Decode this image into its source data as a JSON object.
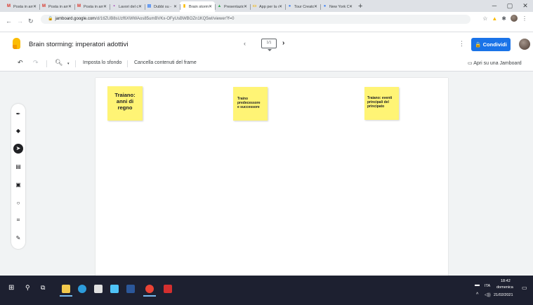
{
  "browser": {
    "tabs": [
      {
        "title": "Posta in arri",
        "icon": "gmail-icon",
        "color": "#d93025",
        "glyph": "M"
      },
      {
        "title": "Posta in arri",
        "icon": "gmail-icon",
        "color": "#d93025",
        "glyph": "M"
      },
      {
        "title": "Posta in arri",
        "icon": "gmail-icon",
        "color": "#d93025",
        "glyph": "M"
      },
      {
        "title": "Lavori del co",
        "icon": "classroom-icon",
        "color": "#9c27b0",
        "glyph": "▪"
      },
      {
        "title": "Dubbi su - ",
        "icon": "forms-icon",
        "color": "#4285f4",
        "glyph": "▤"
      },
      {
        "title": "Brain stormi",
        "icon": "jamboard-icon",
        "color": "#fbbc04",
        "glyph": "▮",
        "active": true
      },
      {
        "title": "Presentazion",
        "icon": "drive-icon",
        "color": "#34a853",
        "glyph": "▲"
      },
      {
        "title": "App per la c",
        "icon": "slides-icon",
        "color": "#f4b400",
        "glyph": "▭"
      },
      {
        "title": "Tour Creator",
        "icon": "tour-creator-icon",
        "color": "#4285f4",
        "glyph": "●"
      },
      {
        "title": "New York Ci",
        "icon": "tour-creator-icon",
        "color": "#4285f4",
        "glyph": "●"
      }
    ],
    "url_host": "jamboard.google.com",
    "url_path": "/d/1tlZUB8sUzf6XWWAos85umBVKx-OFyUsBWBOZn1KQ5wI/viewer?f=0"
  },
  "app": {
    "title": "Brain storming: imperatori adottivi",
    "frame_indicator": "1/1",
    "share_label": "Condividi",
    "share_color": "#1a73e8",
    "toolbar": {
      "set_background": "Imposta lo sfondo",
      "clear_frame": "Cancella contenuti del frame",
      "open_in_jamboard": "Apri su una Jamboard"
    },
    "notes": [
      {
        "text": "Traiano:\nanni di\nregno"
      },
      {
        "text": "Traino\npredecessore\ne successore"
      },
      {
        "text": "Traiano: eventi\nprincipali del\nprincipato"
      }
    ],
    "note_color": "#fff475"
  },
  "taskbar": {
    "lang": "ITA",
    "time": "18:42",
    "day": "domenica",
    "date": "21/02/2021"
  }
}
